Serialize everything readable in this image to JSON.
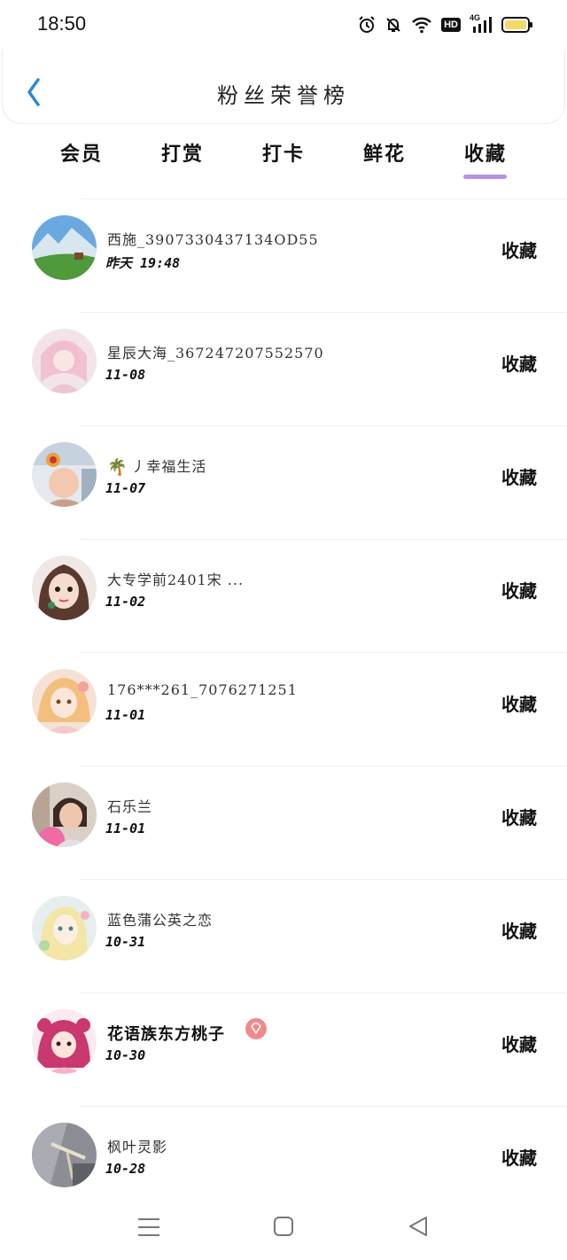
{
  "status_bar": {
    "time": "18:50",
    "icons": [
      "alarm-icon",
      "bell-off-icon",
      "wifi-icon",
      "hd-icon",
      "signal-4g-icon",
      "battery-icon"
    ],
    "hd_label": "HD",
    "network_label": "4G",
    "battery_color": "#f5d86a"
  },
  "header": {
    "title": "粉丝荣誉榜",
    "back_icon": "chevron-left-icon",
    "accent_color": "#2a8ad8"
  },
  "tabs": [
    {
      "label": "会员",
      "active": false
    },
    {
      "label": "打赏",
      "active": false
    },
    {
      "label": "打卡",
      "active": false
    },
    {
      "label": "鲜花",
      "active": false
    },
    {
      "label": "收藏",
      "active": true
    }
  ],
  "tab_indicator_color": "#b892e3",
  "fans": [
    {
      "name": "西施_3907330437134OD55",
      "date": "昨天 19:48",
      "action": "收藏"
    },
    {
      "name": "星辰大海_367247207552570",
      "date": "11-08",
      "action": "收藏"
    },
    {
      "name": "丿幸福生活",
      "date": "11-07",
      "action": "收藏"
    },
    {
      "name": "大专学前2401宋 ...",
      "date": "11-02",
      "action": "收藏"
    },
    {
      "name": "176***261_7076271251",
      "date": "11-01",
      "action": "收藏"
    },
    {
      "name": "石乐兰",
      "date": "11-01",
      "action": "收藏"
    },
    {
      "name": "蓝色蒲公英之恋",
      "date": "10-31",
      "action": "收藏"
    },
    {
      "name": "花语族东方桃子",
      "date": "10-30",
      "action": "收藏"
    },
    {
      "name": "枫叶灵影",
      "date": "10-28",
      "action": "收藏"
    }
  ],
  "nav_bar": {
    "icons": [
      "menu-icon",
      "home-square-icon",
      "back-triangle-icon"
    ]
  }
}
